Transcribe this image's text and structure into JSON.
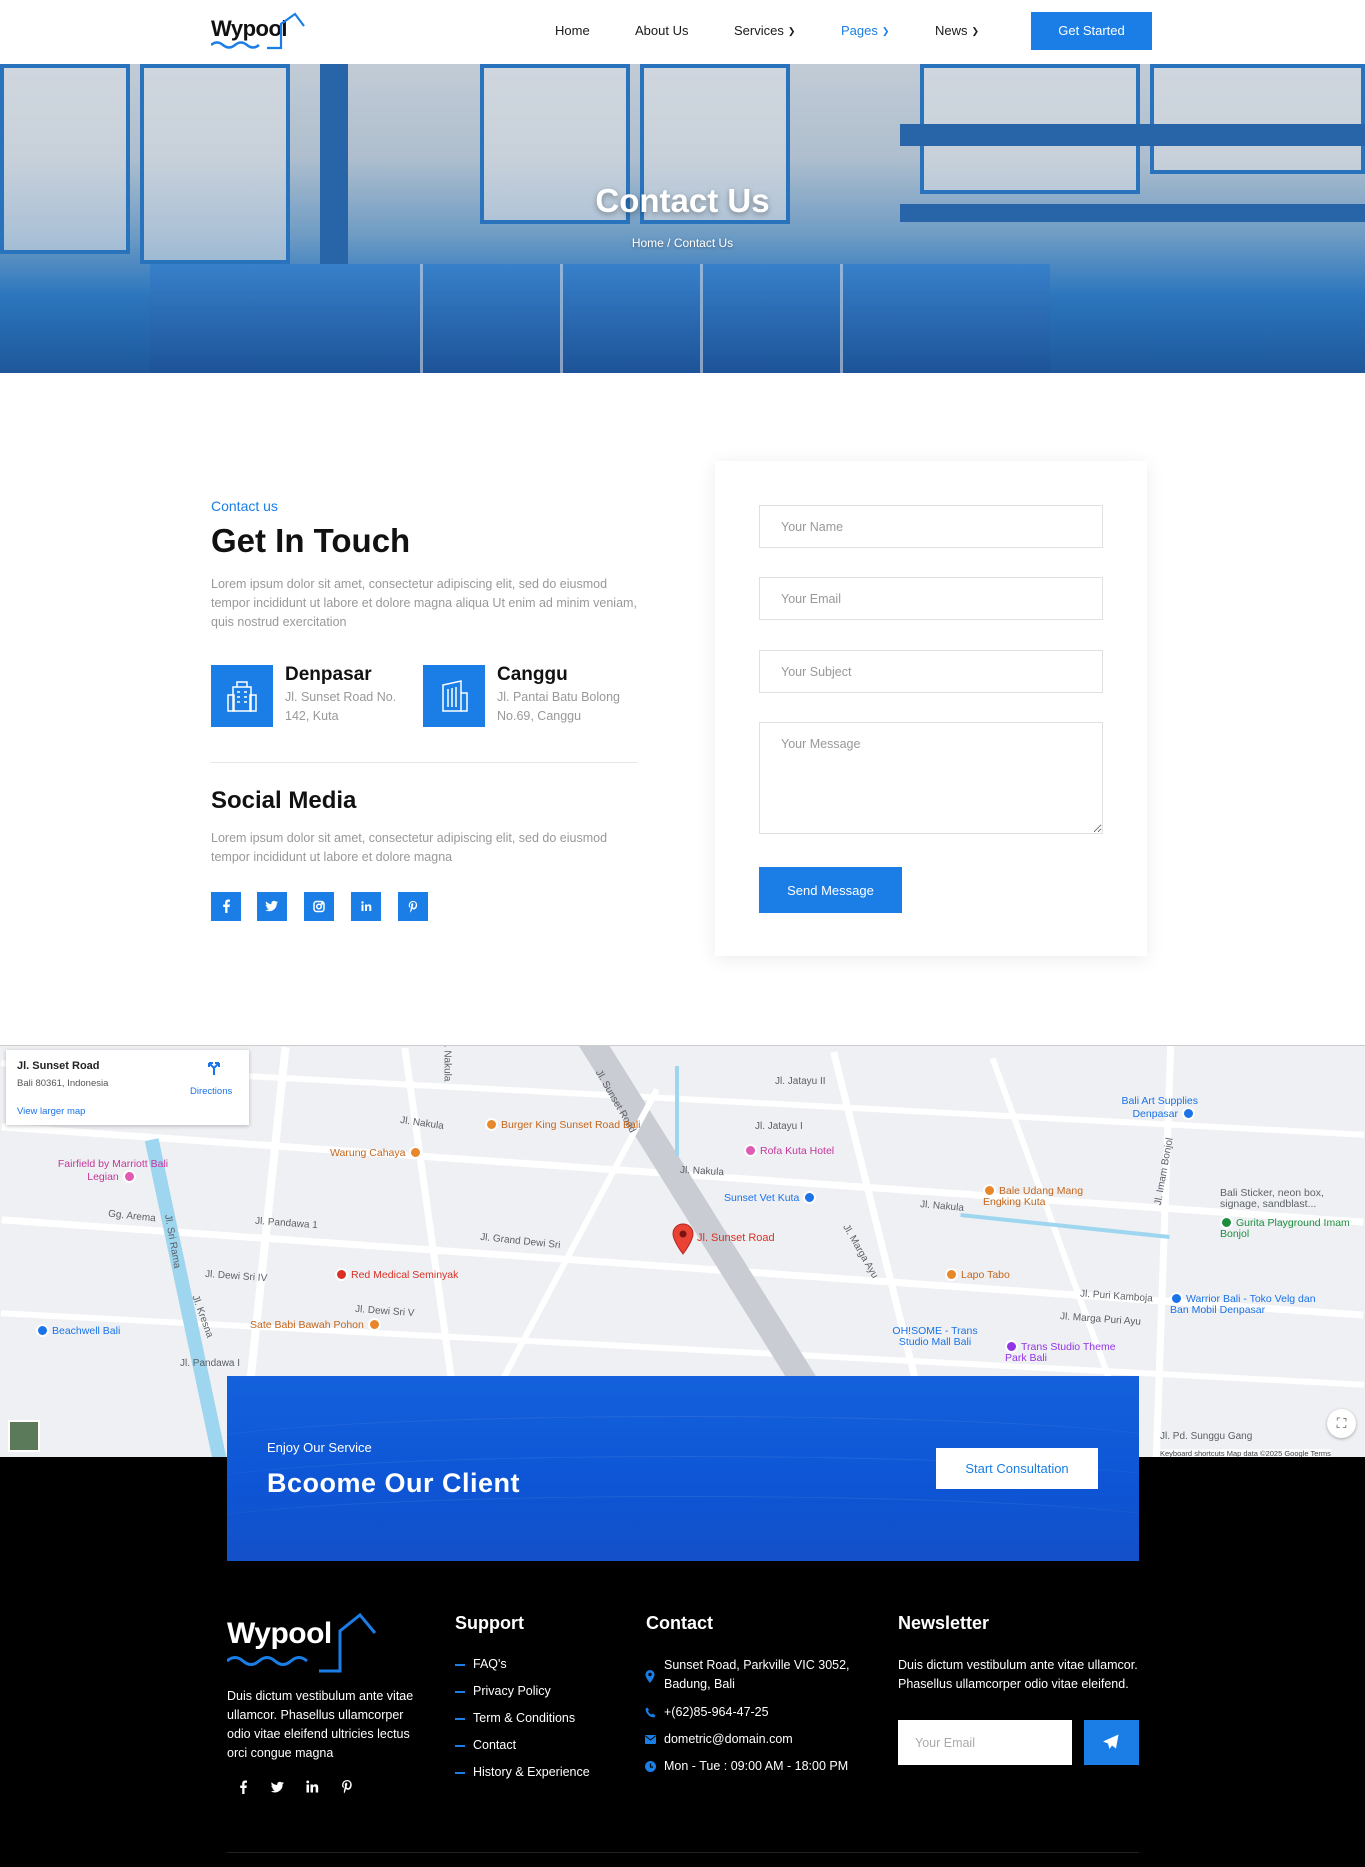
{
  "header": {
    "logo_text": "Wypool",
    "nav": [
      {
        "label": "Home"
      },
      {
        "label": "About Us"
      },
      {
        "label": "Services"
      },
      {
        "label": "Pages"
      },
      {
        "label": "News"
      }
    ],
    "cta_label": "Get Started"
  },
  "hero": {
    "title": "Contact Us",
    "breadcrumb": "Home / Contact Us"
  },
  "contact": {
    "eyebrow": "Contact us",
    "title": "Get In Touch",
    "intro": "Lorem ipsum dolor sit amet, consectetur adipiscing elit, sed do eiusmod tempor incididunt ut labore et dolore magna aliqua Ut enim ad minim veniam, quis nostrud exercitation",
    "locations": [
      {
        "name": "Denpasar",
        "address": "Jl. Sunset Road No. 142, Kuta"
      },
      {
        "name": "Canggu",
        "address": "Jl. Pantai Batu Bolong No.69, Canggu"
      }
    ],
    "social_title": "Social Media",
    "social_text": "Lorem ipsum dolor sit amet, consectetur adipiscing elit, sed do eiusmod tempor incididunt ut labore et dolore magna",
    "social_icons": [
      "f",
      "t",
      "ig",
      "in",
      "p"
    ]
  },
  "form": {
    "name_placeholder": "Your Name",
    "email_placeholder": "Your Email",
    "subject_placeholder": "Your Subject",
    "message_placeholder": "Your Message",
    "submit_label": "Send Message"
  },
  "map": {
    "card_title": "Jl. Sunset Road",
    "card_subtitle": "Bali 80361, Indonesia",
    "card_link": "View larger map",
    "card_directions": "Directions",
    "pin_label": "Jl. Sunset Road",
    "streets": [
      "Jl. Nakula",
      "Jl. Dewi Sri IV",
      "Jl. Pandawa 1",
      "Jl. Grand Dewi Sri",
      "Jl. Jatayu II",
      "Jl. Jatayu I",
      "Jl. Marga Ayu",
      "Jl. Imam Bonjol",
      "Jl. Dewi Sri V",
      "Jl. Pandawa I",
      "Gg. Arema",
      "Jl. Sri Rama",
      "Jl. Kresna",
      "Jl. Sunset Road",
      "Jl. Puri Kamboja",
      "Jl. Marga Puri Ayu",
      "Jl. Pd. Sunggu Gang"
    ],
    "places": [
      {
        "name": "Burger King Sunset Road Bali",
        "color": "#e8872a"
      },
      {
        "name": "Warung Cahaya",
        "color": "#e8872a"
      },
      {
        "name": "Rofa Kuta Hotel",
        "color": "#e05ab3"
      },
      {
        "name": "Sunset Vet Kuta",
        "color": "#1a73e8"
      },
      {
        "name": "Bale Udang Mang Engking Kuta",
        "color": "#e8872a"
      },
      {
        "name": "Bali Art Supplies Denpasar",
        "color": "#1a73e8"
      },
      {
        "name": "Bali Sticker, neon box, signage, sandblast...",
        "color": "#7a7a7a"
      },
      {
        "name": "Gurita Playground Imam Bonjol",
        "color": "#1e8e3e"
      },
      {
        "name": "Fairfield by Marriott Bali Legian",
        "color": "#e05ab3"
      },
      {
        "name": "Red Medical Seminyak",
        "color": "#d93025"
      },
      {
        "name": "Sate Babi Bawah Pohon",
        "color": "#e8872a"
      },
      {
        "name": "Beachwell Bali",
        "color": "#1a73e8"
      },
      {
        "name": "Lapo Tabo",
        "color": "#e8872a"
      },
      {
        "name": "OH!SOME - Trans Studio Mall Bali",
        "color": "#1a73e8"
      },
      {
        "name": "Trans Studio Theme Park Bali",
        "color": "#9334e6"
      },
      {
        "name": "Warrior Bali - Toko Velg dan Ban Mobil Denpasar",
        "color": "#1a73e8"
      }
    ],
    "footer_text": "Keyboard shortcuts   Map data ©2025 Google   Terms"
  },
  "cta": {
    "eyebrow": "Enjoy Our Service",
    "title": "Bcoome Our Client",
    "button": "Start Consultation"
  },
  "footer": {
    "logo_text": "Wypool",
    "about": "Duis dictum vestibulum ante vitae ullamcor. Phasellus ullamcorper odio vitae eleifend ultricies lectus orci congue magna",
    "social_icons": [
      "f",
      "t",
      "in",
      "p"
    ],
    "support_title": "Support",
    "support_links": [
      "FAQ's",
      "Privacy Policy",
      "Term & Conditions",
      "Contact",
      "History & Experience"
    ],
    "contact_title": "Contact",
    "contact_items": [
      {
        "icon": "location-icon",
        "text": "Sunset Road, Parkville VIC 3052, Badung, Bali"
      },
      {
        "icon": "phone-icon",
        "text": "+(62)85-964-47-25"
      },
      {
        "icon": "mail-icon",
        "text": "dometric@domain.com"
      },
      {
        "icon": "clock-icon",
        "text": "Mon - Tue : 09:00 AM - 18:00 PM"
      }
    ],
    "newsletter_title": "Newsletter",
    "newsletter_text": "Duis dictum vestibulum ante vitae ullamcor. Phasellus ullamcorper odio vitae eleifend.",
    "email_placeholder": "Your Email"
  },
  "colors": {
    "accent": "#1a7ee6",
    "cta_blue": "#0d55d5",
    "footer_bg": "#000000"
  }
}
